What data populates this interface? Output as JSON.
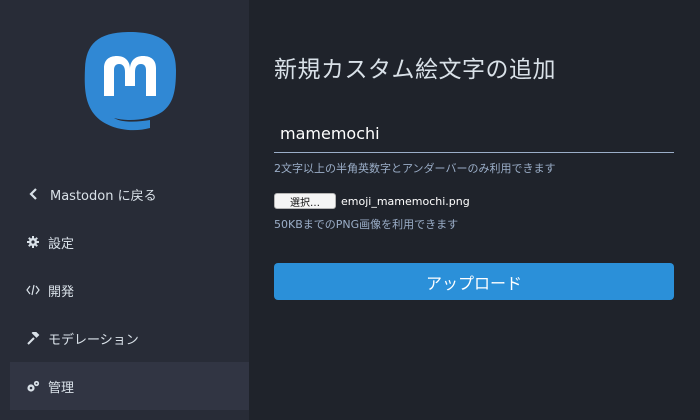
{
  "sidebar": {
    "logo": "mastodon-logo",
    "items": [
      {
        "label": "Mastodon に戻る",
        "icon": "chevron-left-icon",
        "active": false
      },
      {
        "label": "設定",
        "icon": "gear-icon",
        "active": false
      },
      {
        "label": "開発",
        "icon": "code-icon",
        "active": false
      },
      {
        "label": "モデレーション",
        "icon": "gavel-icon",
        "active": false
      },
      {
        "label": "管理",
        "icon": "gears-icon",
        "active": true
      }
    ]
  },
  "main": {
    "title": "新規カスタム絵文字の追加",
    "shortcode": {
      "value": "mamemochi",
      "hint": "2文字以上の半角英数字とアンダーバーのみ利用できます"
    },
    "file": {
      "button_label": "選択…",
      "file_name": "emoji_mamemochi.png",
      "hint": "50KBまでのPNG画像を利用できます"
    },
    "upload_label": "アップロード"
  },
  "colors": {
    "sidebar_bg": "#282c37",
    "main_bg": "#1f232b",
    "accent": "#2b90d9",
    "text": "#d9e1e8",
    "hint": "#9baec8"
  }
}
